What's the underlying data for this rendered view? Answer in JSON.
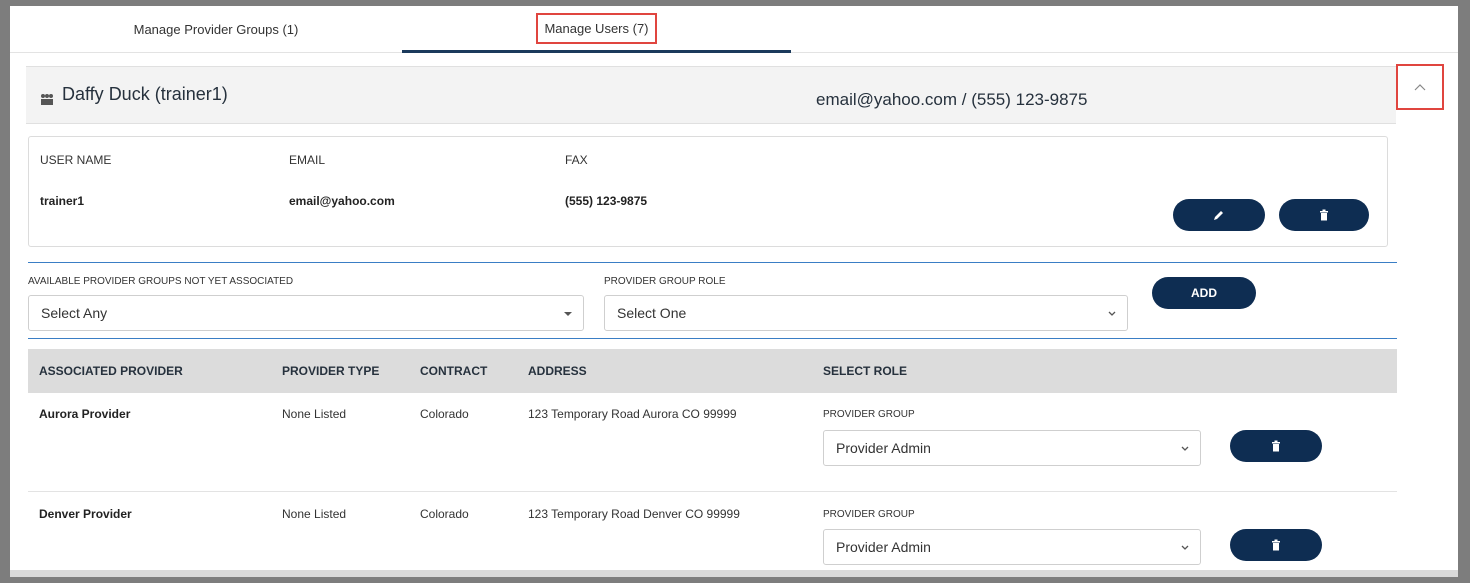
{
  "tabs": [
    {
      "label": "Manage Provider Groups (1)"
    },
    {
      "label": "Manage Users (7)"
    }
  ],
  "user_header": {
    "title": "Daffy Duck (trainer1)",
    "contact": "email@yahoo.com / (555) 123-9875",
    "icon": "users-icon"
  },
  "user_card": {
    "columns": [
      "USER NAME",
      "EMAIL",
      "FAX"
    ],
    "values": [
      "trainer1",
      "email@yahoo.com",
      "(555) 123-9875"
    ],
    "edit_icon": "pencil-icon",
    "delete_icon": "trash-icon"
  },
  "add_section": {
    "groups_label": "AVAILABLE PROVIDER GROUPS NOT YET ASSOCIATED",
    "groups_value": "Select Any",
    "role_label": "PROVIDER GROUP ROLE",
    "role_value": "Select One",
    "add_label": "ADD"
  },
  "table": {
    "headers": [
      "ASSOCIATED PROVIDER",
      "PROVIDER TYPE",
      "CONTRACT",
      "ADDRESS",
      "SELECT ROLE"
    ],
    "rows": [
      {
        "provider": "Aurora Provider",
        "type": "None Listed",
        "contract": "Colorado",
        "address": "123 Temporary Road Aurora CO 99999",
        "role_label": "PROVIDER GROUP",
        "role_value": "Provider Admin"
      },
      {
        "provider": "Denver Provider",
        "type": "None Listed",
        "contract": "Colorado",
        "address": "123 Temporary Road Denver CO 99999",
        "role_label": "PROVIDER GROUP",
        "role_value": "Provider Admin"
      }
    ]
  },
  "colors": {
    "navy": "#0e2d52",
    "accent_blue": "#3a7ec5",
    "highlight_red": "#e0453f"
  }
}
